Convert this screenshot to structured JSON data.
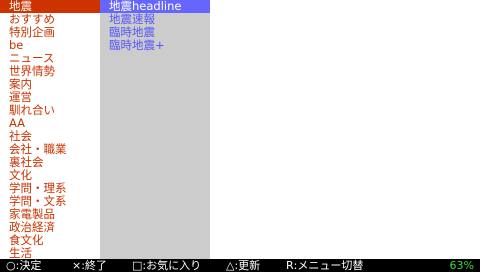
{
  "left_menu": {
    "items": [
      "地震",
      "おすすめ",
      "特別企画",
      "be",
      "ニュース",
      "世界情勢",
      "案内",
      "運営",
      "馴れ合い",
      "AA",
      "社会",
      "会社・職業",
      "裏社会",
      "文化",
      "学問・理系",
      "学問・文系",
      "家電製品",
      "政治経済",
      "食文化",
      "生活"
    ],
    "selected_index": 0
  },
  "right_menu": {
    "items": [
      "地震headline",
      "地震速報",
      "臨時地震",
      "臨時地震+"
    ],
    "selected_index": 0
  },
  "status_bar": {
    "hints": [
      {
        "key": "○",
        "label": ":決定"
      },
      {
        "key": "×",
        "label": ":終了"
      },
      {
        "key": "□",
        "label": ":お気に入り"
      },
      {
        "key": "△",
        "label": ":更新"
      },
      {
        "key": "R",
        "label": ":メニュー切替"
      }
    ],
    "battery": "63%"
  },
  "colors": {
    "left_text": "#cc3300",
    "left_selected_bg": "#cc3300",
    "right_bg": "#cccccc",
    "right_text": "#5555ff",
    "right_selected_bg": "#6666ff",
    "status_bg": "#000000",
    "battery": "#33dd33"
  }
}
